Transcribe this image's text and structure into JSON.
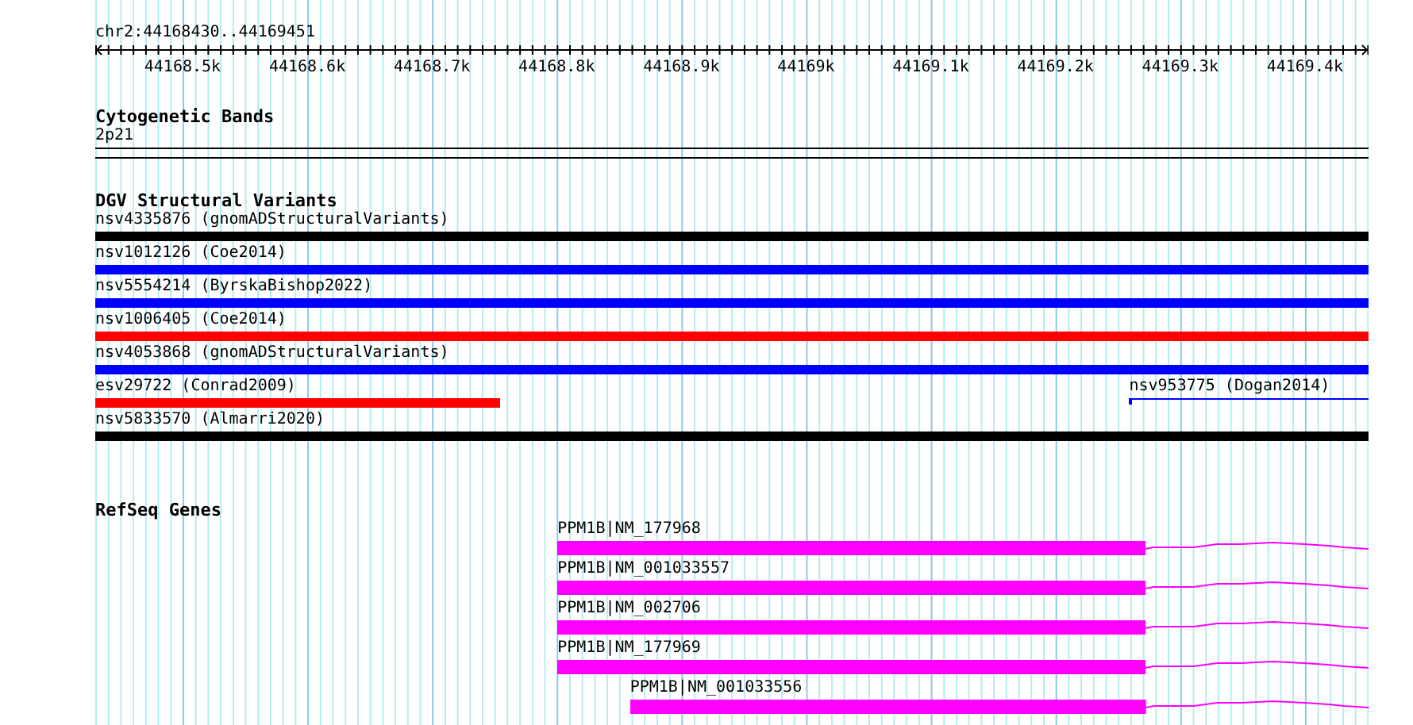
{
  "ruler": {
    "location": "chr2:44168430..44169451",
    "ticks": [
      "44168.5k",
      "44168.6k",
      "44168.7k",
      "44168.8k",
      "44168.9k",
      "44169k",
      "44169.1k",
      "44169.2k",
      "44169.3k",
      "44169.4k"
    ]
  },
  "cytogenetic_bands": {
    "title": "Cytogenetic Bands",
    "band": "2p21"
  },
  "dgv_structural_variants": {
    "title": "DGV Structural Variants",
    "rows": [
      {
        "features": [
          {
            "label": "nsv4335876 (gnomADStructuralVariants)",
            "color": "#000000",
            "kind": "bar"
          }
        ]
      },
      {
        "features": [
          {
            "label": "nsv1012126 (Coe2014)",
            "color": "#0000ff",
            "kind": "bar"
          }
        ]
      },
      {
        "features": [
          {
            "label": "nsv5554214 (ByrskaBishop2022)",
            "color": "#0000ff",
            "kind": "bar"
          }
        ]
      },
      {
        "features": [
          {
            "label": "nsv1006405 (Coe2014)",
            "color": "#ff0000",
            "kind": "bar"
          }
        ]
      },
      {
        "features": [
          {
            "label": "nsv4053868 (gnomADStructuralVariants)",
            "color": "#0000ff",
            "kind": "bar"
          }
        ]
      },
      {
        "features": [
          {
            "label": "esv29722 (Conrad2009)",
            "color": "#ff0000",
            "kind": "bar"
          },
          {
            "label": "nsv953775 (Dogan2014)",
            "color": "#0000ff",
            "kind": "line"
          }
        ]
      },
      {
        "features": [
          {
            "label": "nsv5833570 (Almarri2020)",
            "color": "#000000",
            "kind": "bar"
          }
        ]
      }
    ]
  },
  "refseq_genes": {
    "title": "RefSeq Genes",
    "transcripts": [
      {
        "label": "PPM1B|NM_177968"
      },
      {
        "label": "PPM1B|NM_001033557"
      },
      {
        "label": "PPM1B|NM_002706"
      },
      {
        "label": "PPM1B|NM_177969"
      },
      {
        "label": "PPM1B|NM_001033556"
      }
    ]
  }
}
